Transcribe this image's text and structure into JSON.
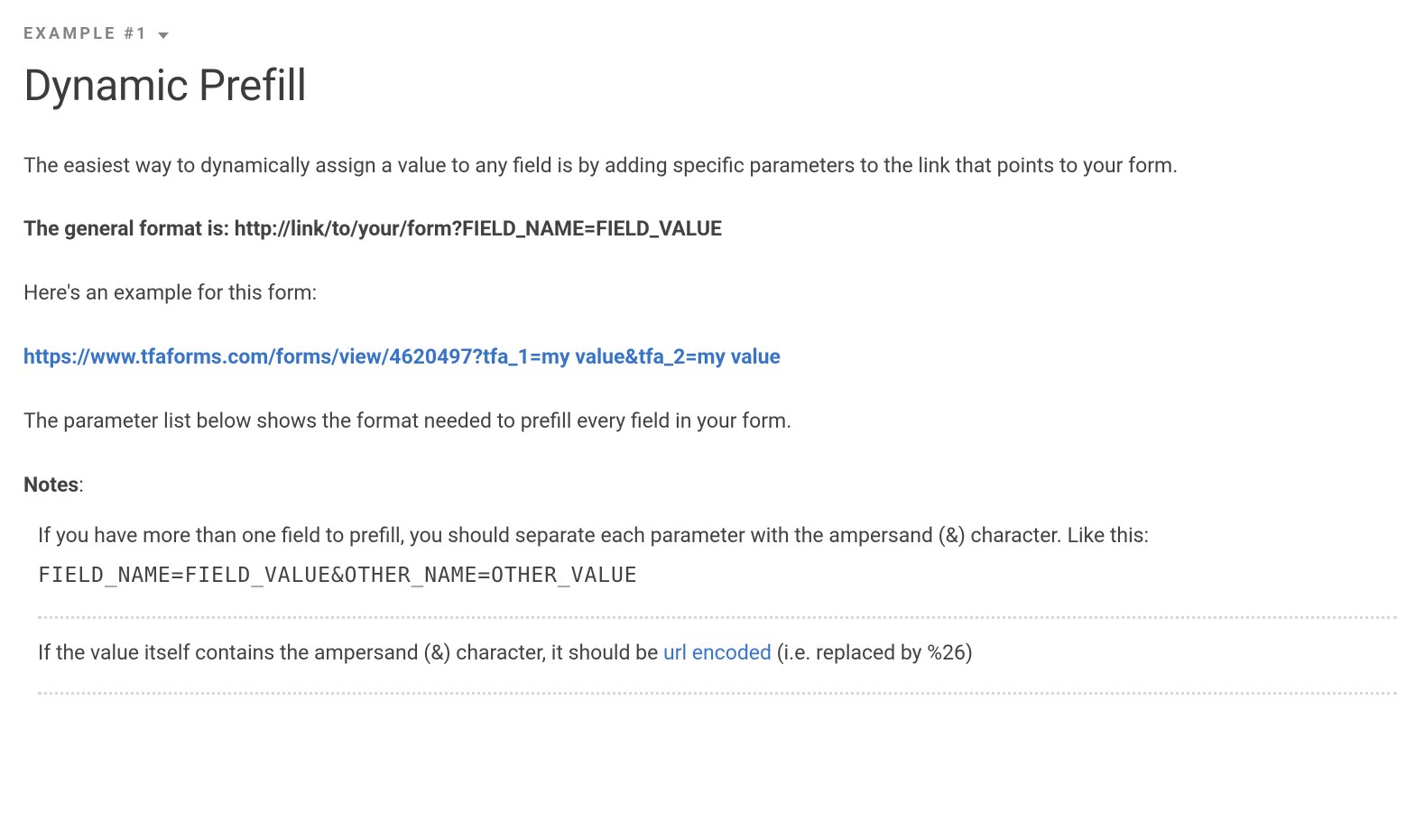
{
  "header": {
    "eyebrow": "EXAMPLE #1",
    "title": "Dynamic Prefill"
  },
  "body": {
    "intro": "The easiest way to dynamically assign a value to any field is by adding specific parameters to the link that points to your form.",
    "format_line_prefix": "The general format is: ",
    "format_line_value": "http://link/to/your/form?FIELD_NAME=FIELD_VALUE",
    "example_intro": "Here's an example for this form:",
    "example_link": "https://www.tfaforms.com/forms/view/4620497?tfa_1=my value&tfa_2=my value",
    "param_list_note": "The parameter list below shows the format needed to prefill every field in your form."
  },
  "notes": {
    "heading_bold": "Notes",
    "heading_suffix": ":",
    "item1_prefix": "If you have more than one field to prefill, you should separate each parameter with the ampersand (&) charac­ter. Like this: ",
    "item1_code": "FIELD_NAME=FIELD_VALUE&OTHER_NAME=OTHER_VALUE",
    "item2_prefix": "If the value itself contains the ampersand (&) character, it should be ",
    "item2_link_text": "url encoded",
    "item2_suffix": " (i.e. replaced by %26)"
  }
}
